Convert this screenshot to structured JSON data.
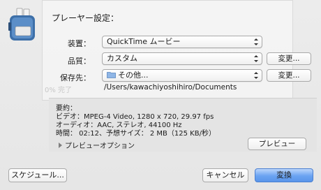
{
  "dialog": {
    "title": "プレーヤー設定：",
    "ghost_text": "0% 完了"
  },
  "fields": {
    "device": {
      "label": "装置：",
      "value": "QuickTime ムービー"
    },
    "quality": {
      "label": "品質：",
      "value": "カスタム",
      "change_button": "変更..."
    },
    "destination": {
      "label": "保存先：",
      "value": "その他...",
      "change_button": "変更..."
    },
    "path": "/Users/kawachiyoshihiro/Documents"
  },
  "summary": {
    "heading": "要約：",
    "video": "ビデオ：MPEG-4 Video, 1280 x 720, 29.97 fps",
    "audio": "オーディオ：AAC, ステレオ, 44100 Hz",
    "time": "時間： 02:12、予想サイズ： 2 MB（125 KB/秒）",
    "preview_options": "プレビューオプション",
    "preview_button": "プレビュー"
  },
  "footer": {
    "schedule_button": "スケジュール...",
    "cancel_button": "キャンセル",
    "convert_button": "変換"
  },
  "colors": {
    "accent": "#5a95ea",
    "background": "#e9e9e9"
  }
}
